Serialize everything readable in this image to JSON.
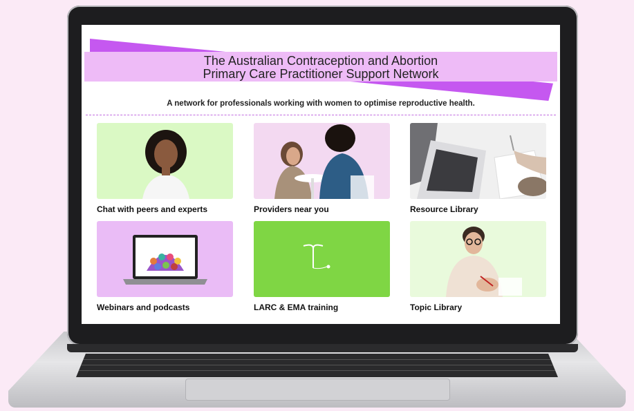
{
  "banner": {
    "line1": "The Australian Contraception and Abortion",
    "line2": "Primary Care Practitioner Support Network"
  },
  "tagline": "A network for professionals working with women to optimise reproductive health.",
  "cards": [
    {
      "label": "Chat with peers and experts",
      "bg": "#daf9c4"
    },
    {
      "label": "Providers near you",
      "bg": "#f3d9f1"
    },
    {
      "label": "Resource Library",
      "bg": "#eeeeee"
    },
    {
      "label": "Webinars and podcasts",
      "bg": "#eabcf6"
    },
    {
      "label": "LARC & EMA training",
      "bg": "#7fd644"
    },
    {
      "label": "Topic Library",
      "bg": "#e9fadc"
    }
  ],
  "colors": {
    "ribbon": "#c558f0",
    "banner": "#eebbf7",
    "page_background": "#fbeaf6"
  }
}
